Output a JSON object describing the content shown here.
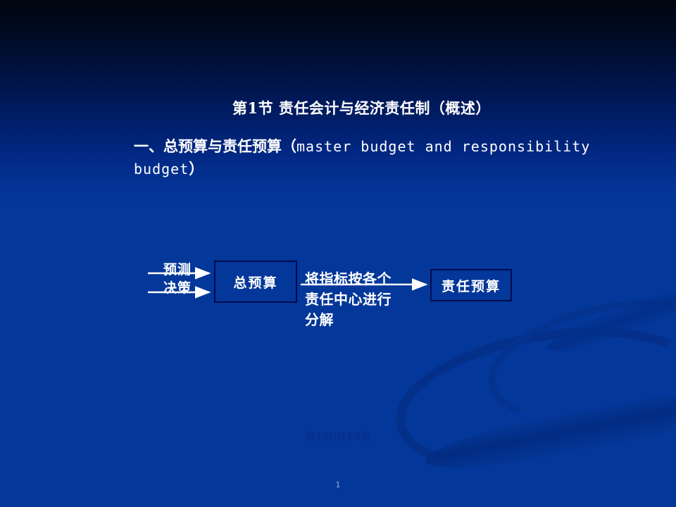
{
  "slide": {
    "background_top_color": "#000510",
    "background_bottom_color": "#033799",
    "title": "第1节 责任会计与经济责任制（概述）",
    "subtitle": {
      "chinese_lead": "一、总预算与责任预算（",
      "english": "master  budget  and responsibility budget",
      "chinese_close": "）"
    }
  },
  "diagram": {
    "type": "flow",
    "nodes": [
      {
        "id": "master-budget",
        "label": "总预算"
      },
      {
        "id": "responsibility-budget",
        "label": "责任预算"
      }
    ],
    "edges": [
      {
        "id": "forecast",
        "label": "预测",
        "from": "",
        "to": "master-budget"
      },
      {
        "id": "decision",
        "label": "决策",
        "from": "",
        "to": "master-budget"
      },
      {
        "id": "decompose",
        "label": "将指标按各个责任中心进行分解",
        "from": "master-budget",
        "to": "responsibility-budget"
      }
    ],
    "decompose_lines": [
      "将指标按各个",
      "责任中心进行",
      "分解"
    ]
  },
  "footer": {
    "page_indicator": "第1页/共68页",
    "slide_number": "1"
  }
}
